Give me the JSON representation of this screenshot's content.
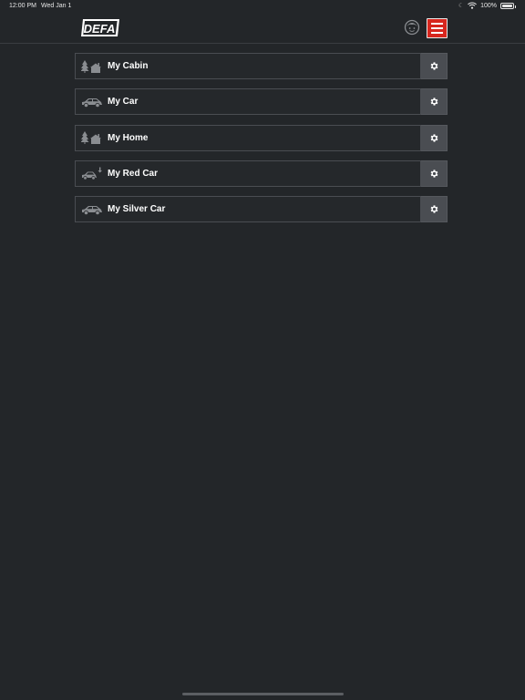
{
  "status_bar": {
    "time": "12:00 PM",
    "date": "Wed Jan 1",
    "battery": "100%",
    "icons": [
      "moon-icon",
      "wifi-icon",
      "battery-icon"
    ]
  },
  "header": {
    "logo_text": "DEFA",
    "avatar_icon": "user-avatar-icon",
    "menu_icon": "hamburger-menu-icon",
    "colors": {
      "menu_button": "#d7261e",
      "background": "#232629"
    }
  },
  "devices": [
    {
      "label": "My Cabin",
      "icon": "cabin-icon"
    },
    {
      "label": "My Car",
      "icon": "car-icon"
    },
    {
      "label": "My Home",
      "icon": "home-icon"
    },
    {
      "label": "My Red Car",
      "icon": "car-alert-icon"
    },
    {
      "label": "My Silver Car",
      "icon": "car-icon"
    }
  ],
  "settings_icon": "gear-icon"
}
